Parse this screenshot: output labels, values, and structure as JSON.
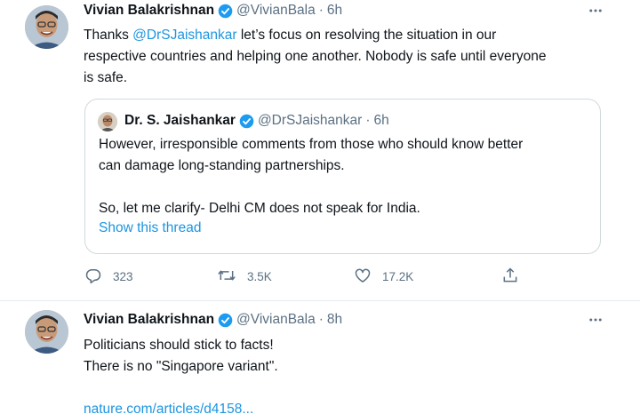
{
  "tweets": [
    {
      "author_name": "Vivian Balakrishnan",
      "handle": "@VivianBala",
      "separator": "·",
      "time": "6h",
      "text_mention": "@DrSJaishankar",
      "text_before": "Thanks ",
      "text_line1_after": " let’s focus on resolving the situation in our",
      "text_line2": "respective countries and helping one another. Nobody is safe until everyone",
      "text_line3": "is safe.",
      "quote": {
        "author_name": "Dr. S. Jaishankar",
        "handle": "@DrSJaishankar",
        "separator": "·",
        "time": "6h",
        "line1": "However, irresponsible comments from those who should know better",
        "line2": "can damage long-standing partnerships.",
        "line3": "So, let me clarify- Delhi CM does not speak for India.",
        "thread_link": "Show this thread"
      },
      "actions": {
        "replies": "323",
        "retweets": "3.5K",
        "likes": "17.2K"
      }
    },
    {
      "author_name": "Vivian Balakrishnan",
      "handle": "@VivianBala",
      "separator": "·",
      "time": "8h",
      "line1": "Politicians should stick to facts!",
      "line2": "There is no \"Singapore variant\".",
      "link": "nature.com/articles/d4158..."
    }
  ],
  "icons": {
    "verified": "verified-badge-icon",
    "more": "more-options-icon",
    "reply": "reply-icon",
    "retweet": "retweet-icon",
    "like": "like-icon",
    "share": "share-icon"
  },
  "colors": {
    "accent": "#1b95e0",
    "verified": "#1d9bf0",
    "secondary_text": "#5b7083",
    "border": "#cfd9de"
  }
}
